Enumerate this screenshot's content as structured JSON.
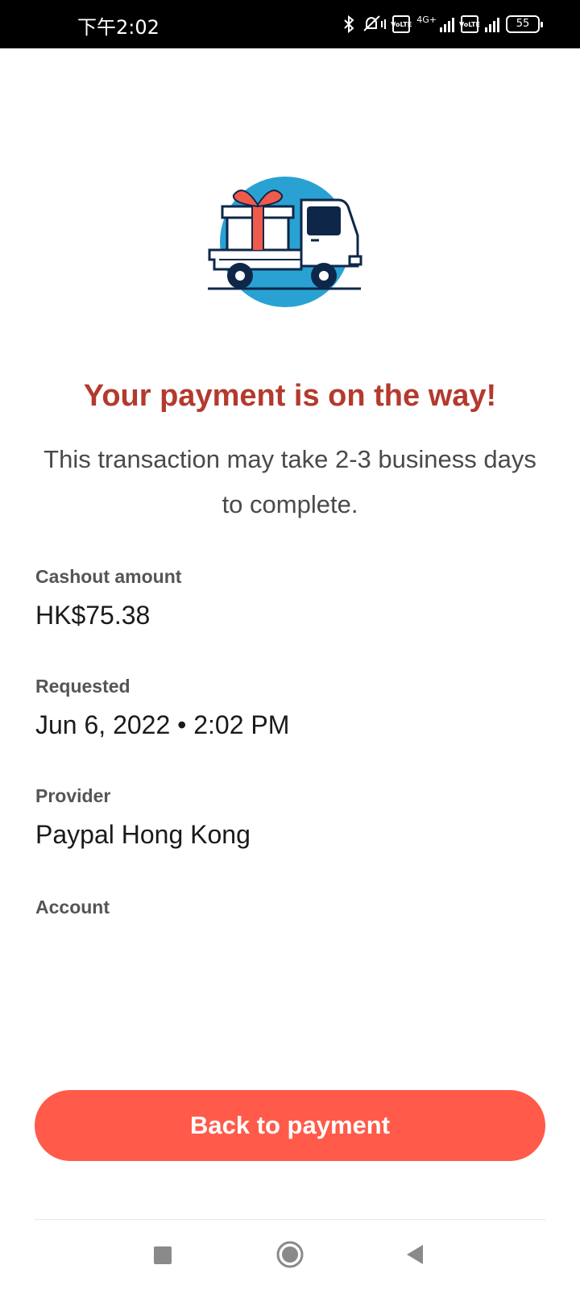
{
  "status_bar": {
    "time": "下午2:02",
    "network": "4G+",
    "volte_label_top": "Vo",
    "volte_label_bottom": "LTE",
    "battery": "55"
  },
  "illustration": {
    "icon": "delivery-truck-with-gift-icon",
    "colors": {
      "circle": "#2aa1d3",
      "ribbon": "#f05a4a",
      "outline": "#0e2748",
      "window": "#0e2748"
    }
  },
  "confirmation": {
    "headline": "Your payment is on the way!",
    "subtext": "This transaction may take 2-3 business days to complete."
  },
  "details": {
    "cashout_label": "Cashout amount",
    "cashout_value": "HK$75.38",
    "requested_label": "Requested",
    "requested_value": "Jun 6, 2022 • 2:02 PM",
    "provider_label": "Provider",
    "provider_value": "Paypal Hong Kong",
    "account_label": "Account",
    "account_value": ""
  },
  "actions": {
    "back_label": "Back to payment"
  },
  "nav": {
    "recent_icon": "square-recents-icon",
    "home_icon": "circle-home-icon",
    "back_icon": "triangle-back-icon"
  },
  "theme": {
    "headline_color": "#b33a2e",
    "button_color": "#ff5a4a"
  }
}
